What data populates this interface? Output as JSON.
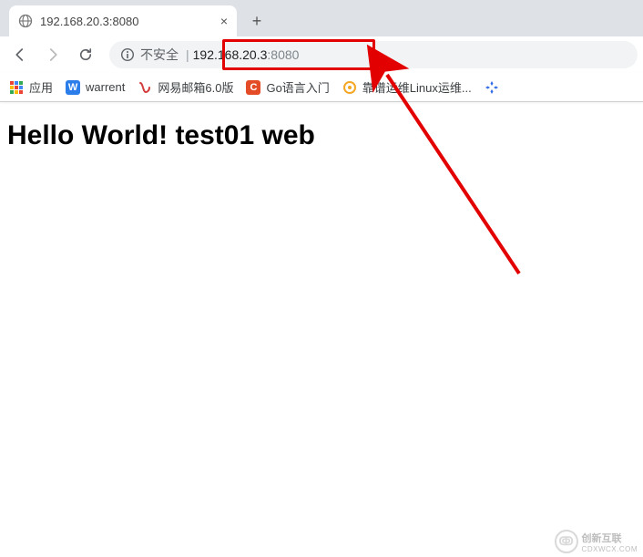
{
  "tab": {
    "title": "192.168.20.3:8080"
  },
  "omnibox": {
    "insecure_label": "不安全",
    "separator": "|",
    "host": "192.168.20.3",
    "port": ":8080"
  },
  "bookmarks": {
    "apps_label": "应用",
    "items": [
      {
        "label": "warrent"
      },
      {
        "label": "网易邮箱6.0版"
      },
      {
        "label": "Go语言入门"
      },
      {
        "label": "靠谱运维Linux运维..."
      }
    ]
  },
  "page": {
    "heading": "Hello World! test01 web"
  },
  "watermark": {
    "brand": "创新互联",
    "sub": "CDXWCX.COM"
  }
}
